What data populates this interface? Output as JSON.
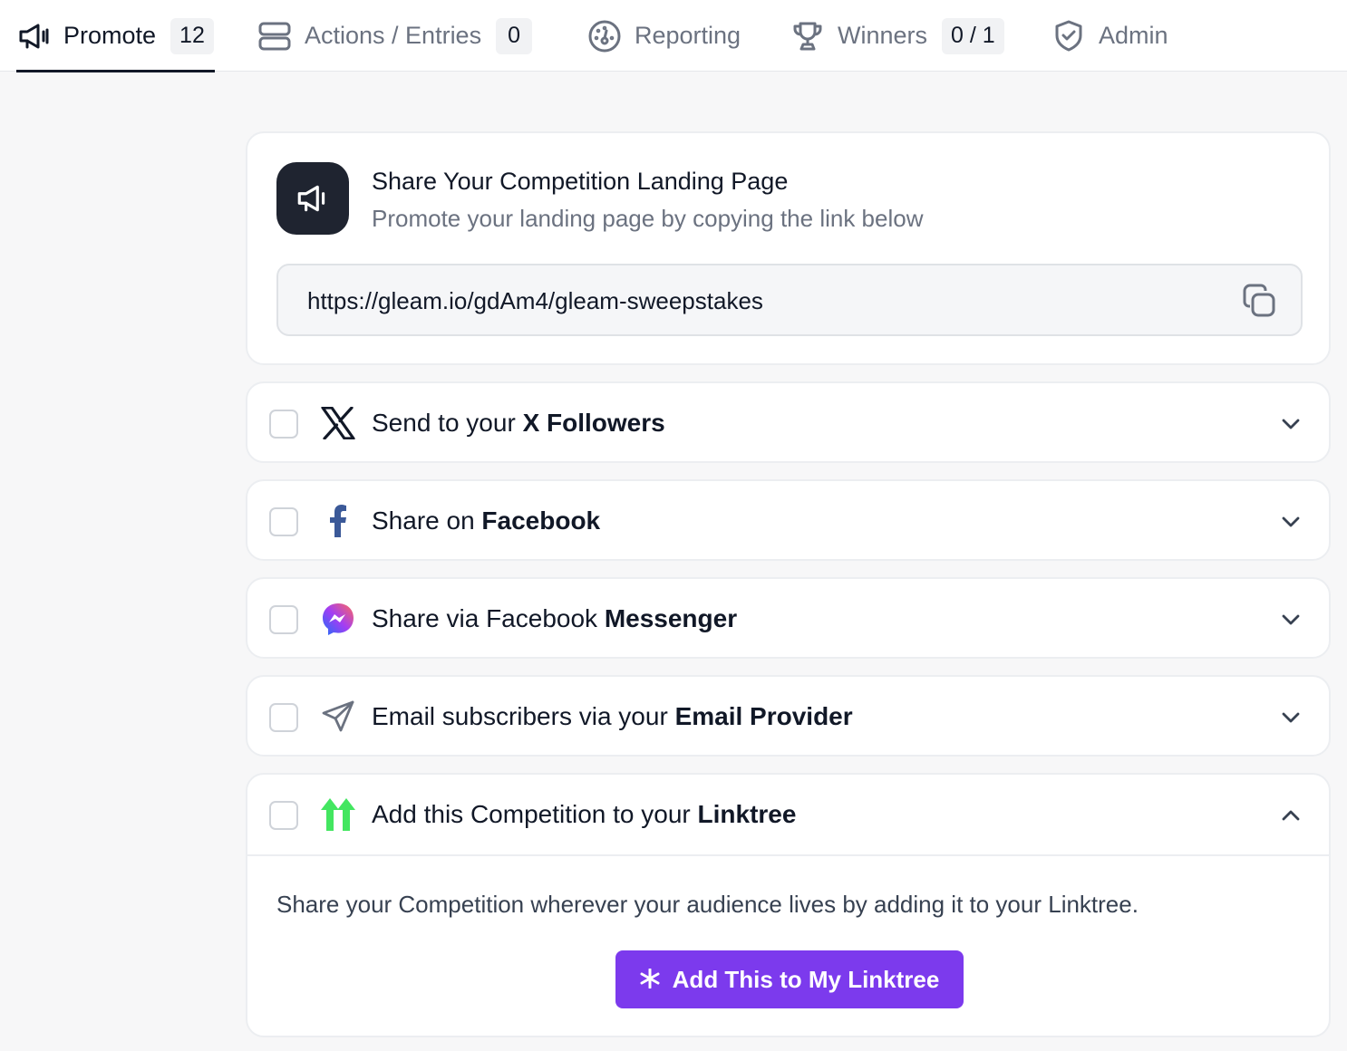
{
  "nav": {
    "tabs": [
      {
        "label": "Promote",
        "badge": "12",
        "icon": "megaphone-icon"
      },
      {
        "label": "Actions / Entries",
        "badge": "0",
        "icon": "stack-icon"
      },
      {
        "label": "Reporting",
        "icon": "gauge-icon"
      },
      {
        "label": "Winners",
        "badge": "0 / 1",
        "icon": "trophy-icon"
      },
      {
        "label": "Admin",
        "icon": "shield-check-icon"
      }
    ],
    "active_tab": "Promote"
  },
  "hero": {
    "icon": "megaphone-icon",
    "title": "Share Your Competition Landing Page",
    "subtitle": "Promote your landing page by copying the link below",
    "url": "https://gleam.io/gdAm4/gleam-sweepstakes",
    "copy_icon": "copy-icon"
  },
  "actions": [
    {
      "icon": "x-logo-icon",
      "prefix": "Send to your ",
      "bold": "X Followers",
      "checked": false,
      "expanded": false
    },
    {
      "icon": "facebook-icon",
      "prefix": "Share on ",
      "bold": "Facebook",
      "checked": false,
      "expanded": false
    },
    {
      "icon": "messenger-icon",
      "prefix": "Share via Facebook ",
      "bold": "Messenger",
      "checked": false,
      "expanded": false
    },
    {
      "icon": "paper-plane-icon",
      "prefix": "Email subscribers via your ",
      "bold": "Email Provider",
      "checked": false,
      "expanded": false
    },
    {
      "icon": "linktree-icon",
      "prefix": "Add this Competition to your ",
      "bold": "Linktree",
      "checked": false,
      "expanded": true,
      "body": "Share your Competition wherever your audience lives by adding it to your Linktree.",
      "button_label": "Add This to My Linktree",
      "button_icon": "asterisk-icon"
    }
  ],
  "colors": {
    "accent": "#7c3aed",
    "dark": "#1f2430",
    "facebook": "#3b5998",
    "linktree": "#43e660",
    "muted_text": "#6b7280"
  }
}
